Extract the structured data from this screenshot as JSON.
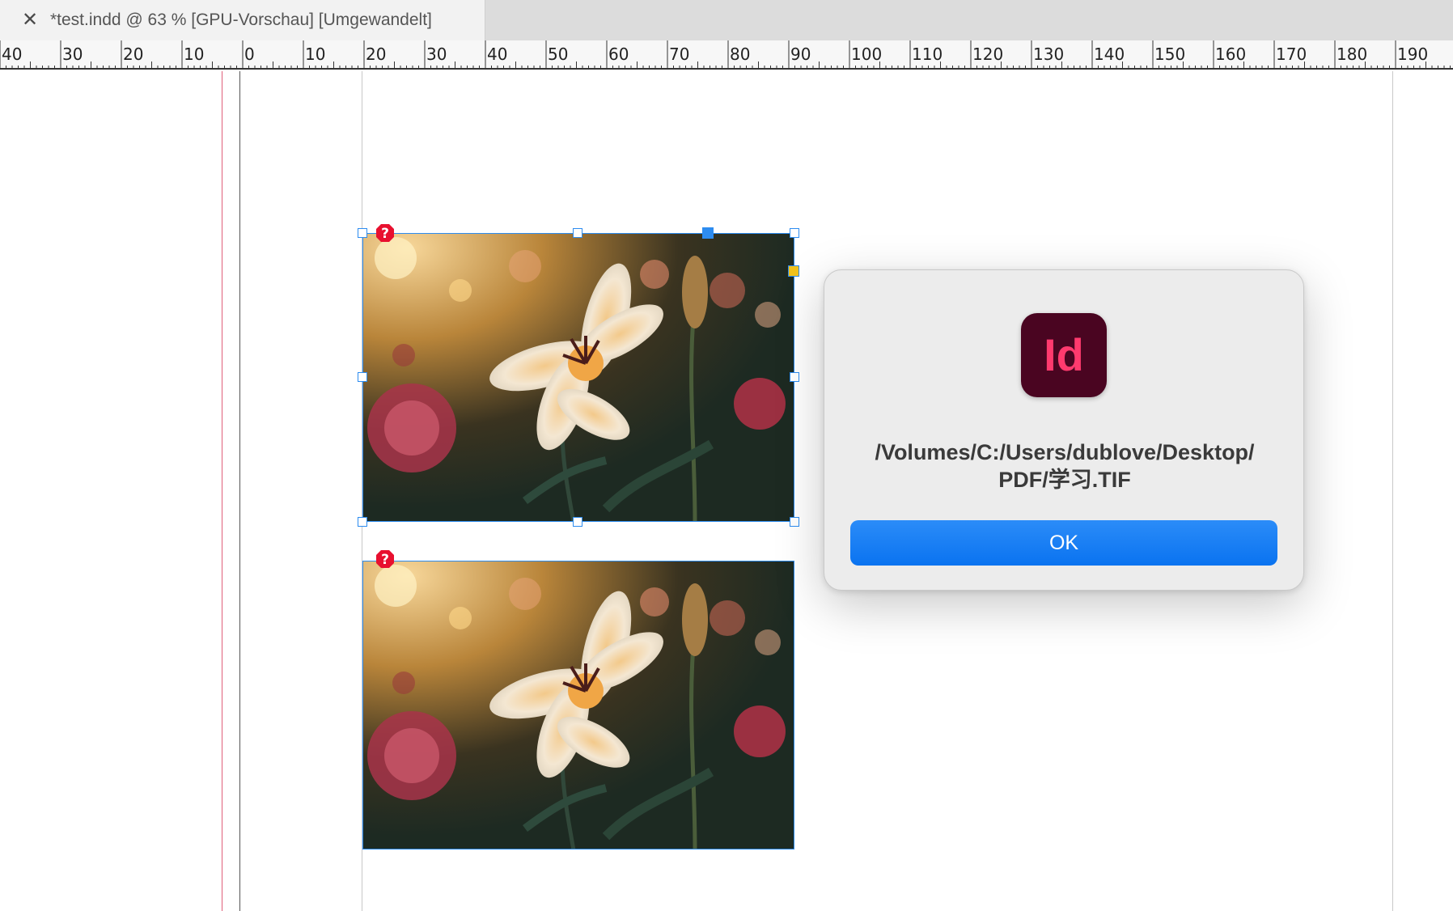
{
  "tab": {
    "close_glyph": "✕",
    "title": "*test.indd @ 63 % [GPU-Vorschau] [Umgewandelt]"
  },
  "ruler": {
    "labels": [
      "40",
      "30",
      "20",
      "10",
      "0",
      "10",
      "20",
      "30",
      "40",
      "50",
      "60",
      "70",
      "80",
      "90",
      "100",
      "110",
      "120",
      "130",
      "140",
      "150",
      "160",
      "170",
      "180",
      "190"
    ]
  },
  "frames": [
    {
      "name": "image-frame-top",
      "selected": true,
      "status_icon": "missing-link-icon"
    },
    {
      "name": "image-frame-bottom",
      "selected": false,
      "status_icon": "missing-link-icon"
    }
  ],
  "dialog": {
    "app_icon": "indesign-app-icon",
    "app_icon_text": "Id",
    "message_line1": "/Volumes/C:/Users/dublove/Desktop/",
    "message_line2": "PDF/学习.TIF",
    "ok_label": "OK"
  },
  "colors": {
    "selection": "#2d8cf0",
    "ok_button": "#0a73f0",
    "app_icon_bg": "#4a0521",
    "app_icon_fg": "#ff3a6e",
    "missing_icon": "#e8102f"
  }
}
